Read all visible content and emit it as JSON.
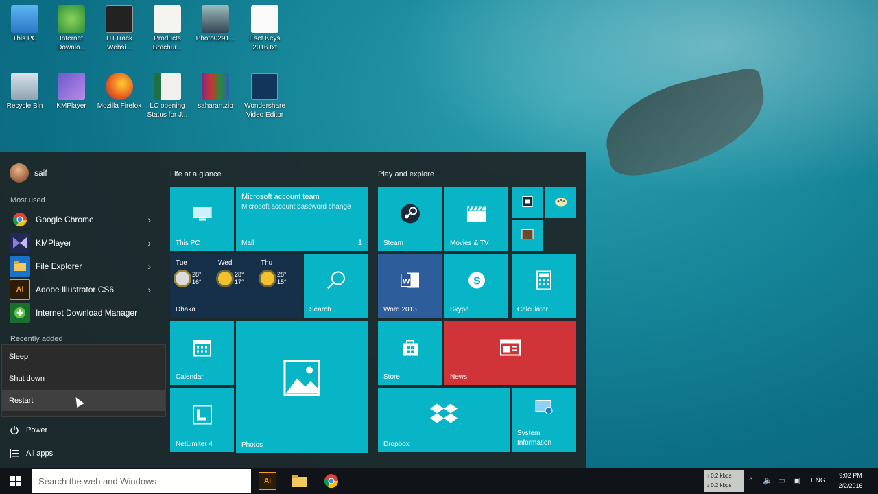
{
  "desktop": {
    "icons": [
      {
        "label": "This PC",
        "icon": "this-pc-icon"
      },
      {
        "label": "Internet Downlo...",
        "icon": "idm-icon"
      },
      {
        "label": "HTTrack Websi...",
        "icon": "httrack-icon"
      },
      {
        "label": "Products Brochur...",
        "icon": "pdf-icon"
      },
      {
        "label": "Photo0291...",
        "icon": "photo-icon"
      },
      {
        "label": "Eset Keys 2016.txt",
        "icon": "text-file-icon"
      },
      {
        "label": "Recycle Bin",
        "icon": "recycle-bin-icon"
      },
      {
        "label": "KMPlayer",
        "icon": "kmplayer-icon"
      },
      {
        "label": "Mozilla Firefox",
        "icon": "firefox-icon"
      },
      {
        "label": "LC opening Status for J...",
        "icon": "excel-icon"
      },
      {
        "label": "saharan.zip",
        "icon": "zip-icon"
      },
      {
        "label": "Wondershare Video Editor",
        "icon": "wondershare-icon"
      }
    ]
  },
  "start_menu": {
    "user_name": "saif",
    "most_used_label": "Most used",
    "most_used": [
      {
        "label": "Google Chrome",
        "icon": "chrome-icon",
        "has_submenu": true
      },
      {
        "label": "KMPlayer",
        "icon": "kmplayer-icon",
        "has_submenu": true
      },
      {
        "label": "File Explorer",
        "icon": "file-explorer-icon",
        "has_submenu": true
      },
      {
        "label": "Adobe Illustrator CS6",
        "icon": "illustrator-icon",
        "has_submenu": true
      },
      {
        "label": "Internet Download Manager",
        "icon": "idm-icon",
        "has_submenu": false
      }
    ],
    "recently_added_label": "Recently added",
    "power_options": [
      "Sleep",
      "Shut down",
      "Restart"
    ],
    "hovered_option": "Restart",
    "power_label": "Power",
    "all_apps_label": "All apps",
    "groups": [
      {
        "title": "Life at a glance"
      },
      {
        "title": "Play and explore"
      }
    ],
    "tiles": {
      "this_pc": "This PC",
      "mail": {
        "label": "Mail",
        "sender": "Microsoft account team",
        "subject": "Microsoft account password change",
        "count": "1"
      },
      "weather": {
        "location": "Dhaka",
        "days": [
          {
            "day": "Tue",
            "high": "28°",
            "low": "16°"
          },
          {
            "day": "Wed",
            "high": "28°",
            "low": "17°"
          },
          {
            "day": "Thu",
            "high": "28°",
            "low": "15°"
          }
        ]
      },
      "search": "Search",
      "calendar": "Calendar",
      "photos": "Photos",
      "netlimiter": "NetLimiter 4",
      "steam": "Steam",
      "movies": "Movies & TV",
      "word": "Word 2013",
      "skype": "Skype",
      "calculator": "Calculator",
      "store": "Store",
      "news": "News",
      "dropbox": "Dropbox",
      "system_info": "System Information"
    }
  },
  "taskbar": {
    "search_placeholder": "Search the web and Windows",
    "speed_up": "0.2 kbps",
    "speed_down": "0.2 kbps",
    "language": "ENG",
    "time": "9:02 PM",
    "date": "2/2/2016"
  },
  "colors": {
    "tile": "#08b5c6",
    "word_tile": "#2e5d9c",
    "news_tile": "#d13438",
    "weather_tile": "#16304a"
  }
}
